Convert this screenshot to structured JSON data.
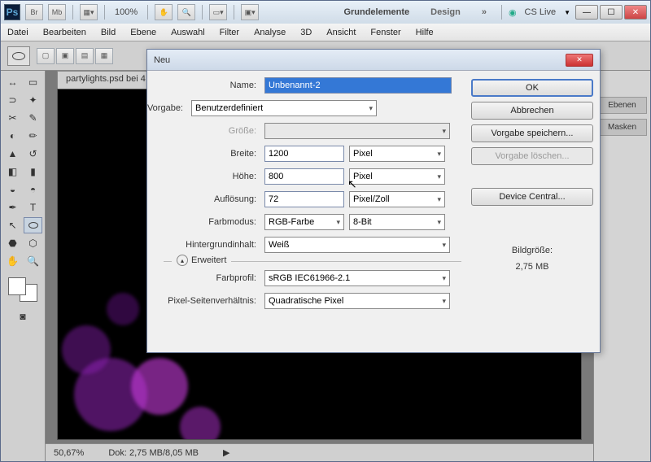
{
  "app": {
    "logo": "Ps"
  },
  "titlebar": {
    "zoom": "100%",
    "tab1": "Grundelemente",
    "tab2": "Design",
    "cslive": "CS Live"
  },
  "menu": [
    "Datei",
    "Bearbeiten",
    "Bild",
    "Ebene",
    "Auswahl",
    "Filter",
    "Analyse",
    "3D",
    "Ansicht",
    "Fenster",
    "Hilfe"
  ],
  "doctab": "partylights.psd bei 4",
  "status": {
    "zoom": "50,67%",
    "dok": "Dok: 2,75 MB/8,05 MB"
  },
  "rpanel": {
    "ebenen": "Ebenen",
    "masken": "Masken"
  },
  "dlg": {
    "title": "Neu",
    "name_lbl": "Name:",
    "name_val": "Unbenannt-2",
    "vorgabe_lbl": "Vorgabe:",
    "vorgabe_val": "Benutzerdefiniert",
    "groesse_lbl": "Größe:",
    "breite_lbl": "Breite:",
    "breite_val": "1200",
    "breite_unit": "Pixel",
    "hoehe_lbl": "Höhe:",
    "hoehe_val": "800",
    "hoehe_unit": "Pixel",
    "aufl_lbl": "Auflösung:",
    "aufl_val": "72",
    "aufl_unit": "Pixel/Zoll",
    "farb_lbl": "Farbmodus:",
    "farb_val": "RGB-Farbe",
    "farb_bit": "8-Bit",
    "hinhalt_lbl": "Hintergrundinhalt:",
    "hinhalt_val": "Weiß",
    "erw": "Erweitert",
    "profil_lbl": "Farbprofil:",
    "profil_val": "sRGB IEC61966-2.1",
    "ratio_lbl": "Pixel-Seitenverhältnis:",
    "ratio_val": "Quadratische Pixel",
    "ok": "OK",
    "cancel": "Abbrechen",
    "save": "Vorgabe speichern...",
    "del": "Vorgabe löschen...",
    "dc": "Device Central...",
    "info_lbl": "Bildgröße:",
    "info_val": "2,75 MB"
  }
}
